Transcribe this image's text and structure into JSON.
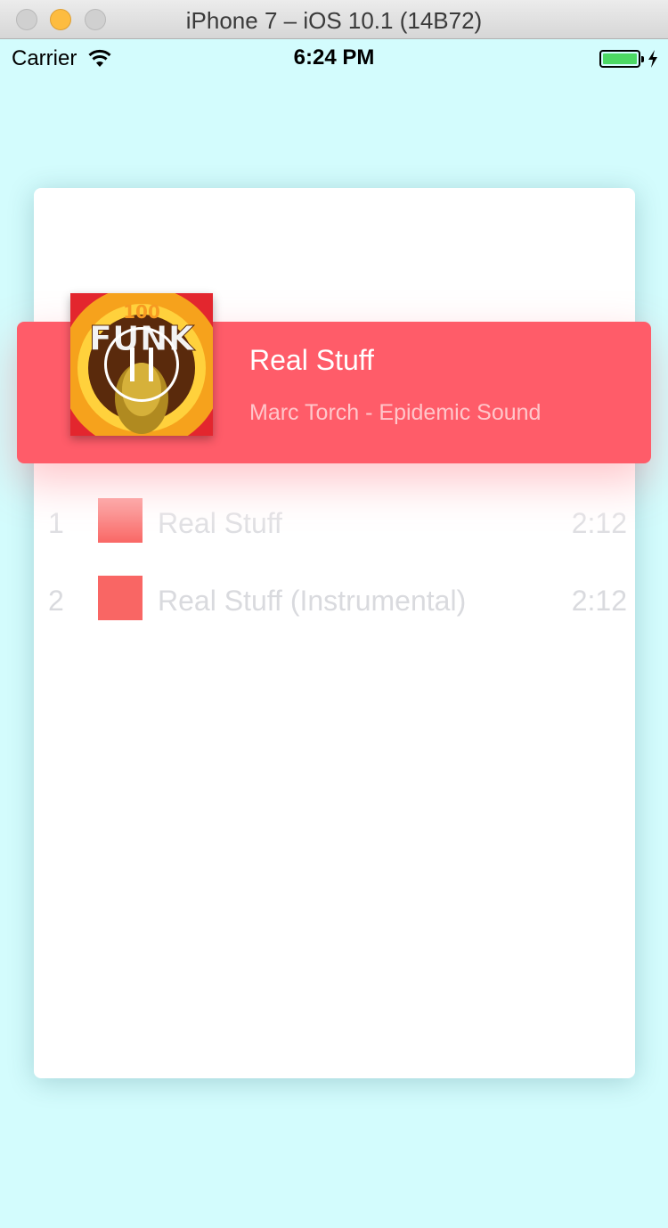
{
  "window": {
    "title": "iPhone 7 – iOS 10.1 (14B72)"
  },
  "status_bar": {
    "carrier": "Carrier",
    "time": "6:24 PM",
    "battery_level": 1.0
  },
  "now_playing": {
    "title": "Real Stuff",
    "artist": "Marc Torch - Epidemic Sound",
    "album_art_text_top": "100",
    "album_art_text_main": "FUNK",
    "state": "playing",
    "banner_color": "#ff5c69"
  },
  "tracks": [
    {
      "number": "1",
      "title": "Real Stuff",
      "duration": "2:12"
    },
    {
      "number": "2",
      "title": "Real Stuff (Instrumental)",
      "duration": "2:12"
    }
  ],
  "colors": {
    "background": "#d3fcfd",
    "card": "#ffffff",
    "track_thumb": "#f96664",
    "track_text": "#d9dade"
  }
}
